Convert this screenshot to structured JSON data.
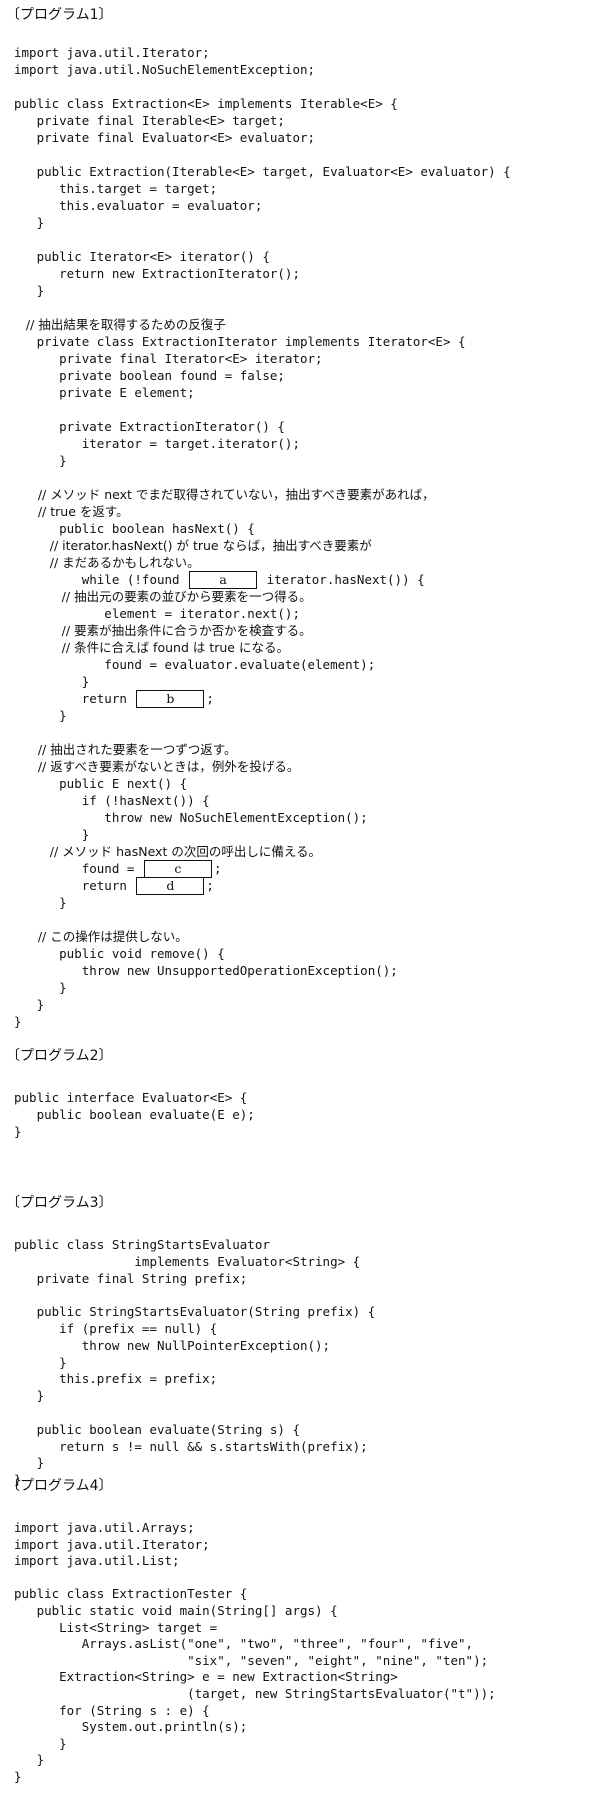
{
  "program1": {
    "heading": "〔プログラム1〕",
    "lines": [
      "import java.util.Iterator;",
      "import java.util.NoSuchElementException;",
      "",
      "public class Extraction<E> implements Iterable<E> {",
      "   private final Iterable<E> target;",
      "   private final Evaluator<E> evaluator;",
      "",
      "   public Extraction(Iterable<E> target, Evaluator<E> evaluator) {",
      "      this.target = target;",
      "      this.evaluator = evaluator;",
      "   }",
      "",
      "   public Iterator<E> iterator() {",
      "      return new ExtractionIterator();",
      "   }",
      "",
      "   // 抽出結果を取得するための反復子",
      "   private class ExtractionIterator implements Iterator<E> {",
      "      private final Iterator<E> iterator;",
      "      private boolean found = false;",
      "      private E element;",
      "",
      "      private ExtractionIterator() {",
      "         iterator = target.iterator();",
      "      }",
      "",
      "      // メソッド next でまだ取得されていない，抽出すべき要素があれば，",
      "      // true を返す。",
      "      public boolean hasNext() {",
      "         // iterator.hasNext() が true ならば，抽出すべき要素が",
      "         // まだあるかもしれない。",
      "         while (!found [a] iterator.hasNext()) {",
      "            // 抽出元の要素の並びから要素を一つ得る。",
      "            element = iterator.next();",
      "            // 要素が抽出条件に合うか否かを検査する。",
      "            // 条件に合えば found は true になる。",
      "            found = evaluator.evaluate(element);",
      "         }",
      "         return [b];",
      "      }",
      "",
      "      // 抽出された要素を一つずつ返す。",
      "      // 返すべき要素がないときは，例外を投げる。",
      "      public E next() {",
      "         if (!hasNext()) {",
      "            throw new NoSuchElementException();",
      "         }",
      "         // メソッド hasNext の次回の呼出しに備える。",
      "         found = [c];",
      "         return [d];",
      "      }",
      "",
      "      // この操作は提供しない。",
      "      public void remove() {",
      "         throw new UnsupportedOperationException();",
      "      }",
      "   }",
      "}"
    ]
  },
  "program2": {
    "heading": "〔プログラム2〕",
    "lines": [
      "public interface Evaluator<E> {",
      "   public boolean evaluate(E e);",
      "}"
    ]
  },
  "program3": {
    "heading": "〔プログラム3〕",
    "lines": [
      "public class StringStartsEvaluator",
      "                implements Evaluator<String> {",
      "   private final String prefix;",
      "",
      "   public StringStartsEvaluator(String prefix) {",
      "      if (prefix == null) {",
      "         throw new NullPointerException();",
      "      }",
      "      this.prefix = prefix;",
      "   }",
      "",
      "   public boolean evaluate(String s) {",
      "      return s != null && s.startsWith(prefix);",
      "   }",
      "}"
    ]
  },
  "program4": {
    "heading": "〔プログラム4〕",
    "lines": [
      "import java.util.Arrays;",
      "import java.util.Iterator;",
      "import java.util.List;",
      "",
      "public class ExtractionTester {",
      "   public static void main(String[] args) {",
      "      List<String> target =",
      "         Arrays.asList(\"one\", \"two\", \"three\", \"four\", \"five\",",
      "                       \"six\", \"seven\", \"eight\", \"nine\", \"ten\");",
      "      Extraction<String> e = new Extraction<String>",
      "                       (target, new StringStartsEvaluator(\"t\"));",
      "      for (String s : e) {",
      "         System.out.println(s);",
      "      }",
      "   }",
      "}"
    ]
  },
  "blanks": {
    "a": "a",
    "b": "b",
    "c": "c",
    "d": "d"
  }
}
